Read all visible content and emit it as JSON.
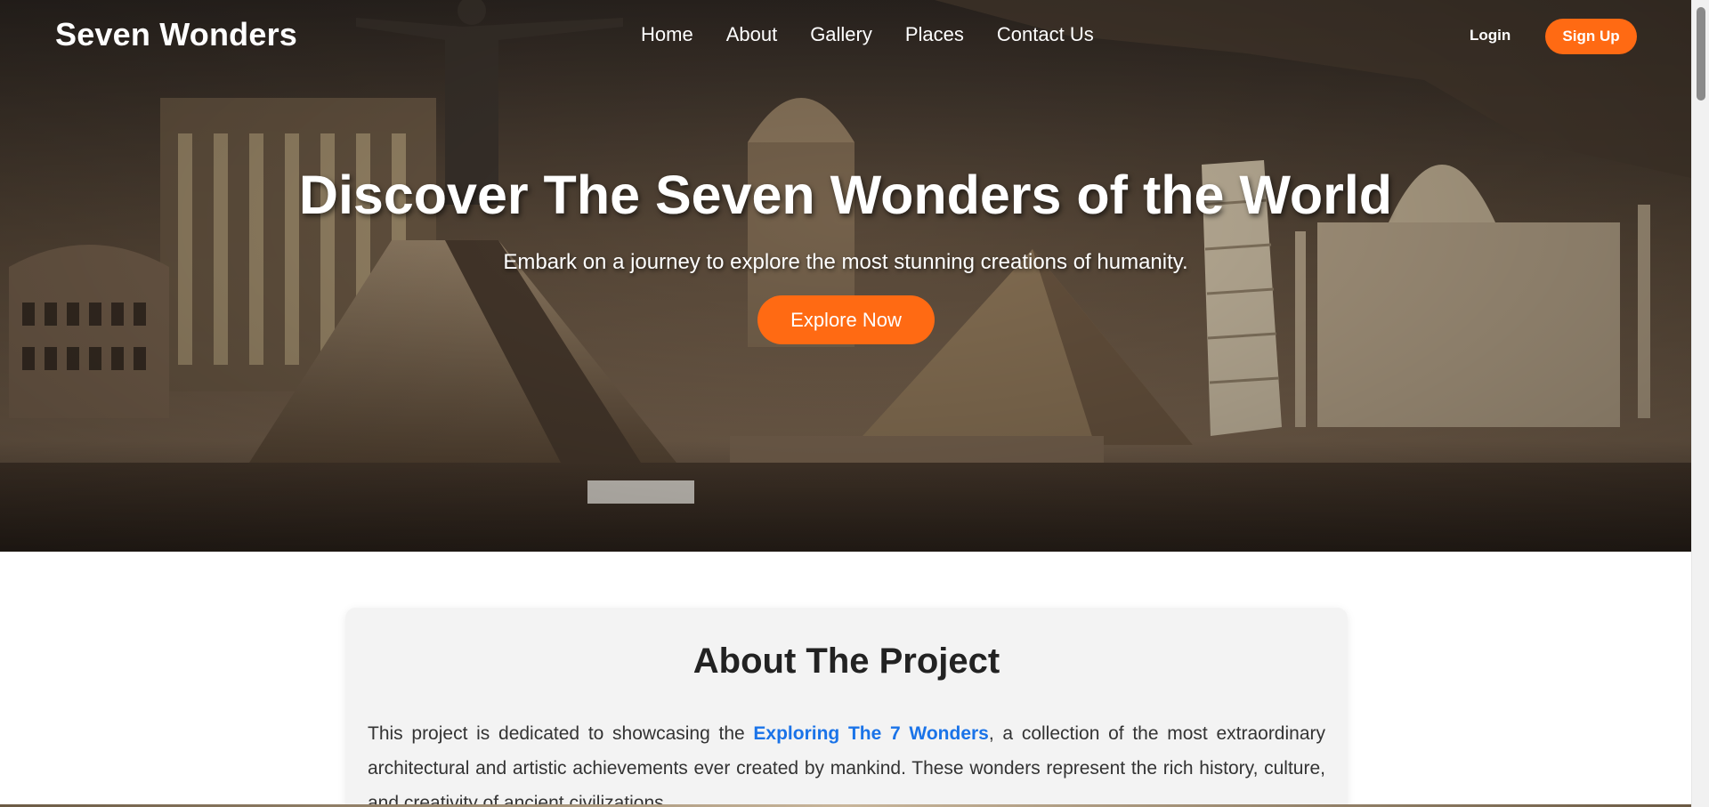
{
  "site": {
    "logo": "Seven Wonders"
  },
  "nav": {
    "links": [
      "Home",
      "About",
      "Gallery",
      "Places",
      "Contact Us"
    ],
    "login": "Login",
    "signup": "Sign Up"
  },
  "hero": {
    "title": "Discover The Seven Wonders of the World",
    "subtitle": "Embark on a journey to explore the most stunning creations of humanity.",
    "cta": "Explore Now",
    "background_image": "collage-of-world-wonders"
  },
  "about": {
    "title": "About The Project",
    "text_before": "This project is dedicated to showcasing the ",
    "highlight": "Exploring The 7 Wonders",
    "text_after": ", a collection of the most extraordinary architectural and artistic achievements ever created by mankind. These wonders represent the rich history, culture, and creativity of ancient civilizations."
  },
  "colors": {
    "accent": "#ff6a13",
    "link": "#1a73e8",
    "card_bg": "#f3f3f3"
  }
}
